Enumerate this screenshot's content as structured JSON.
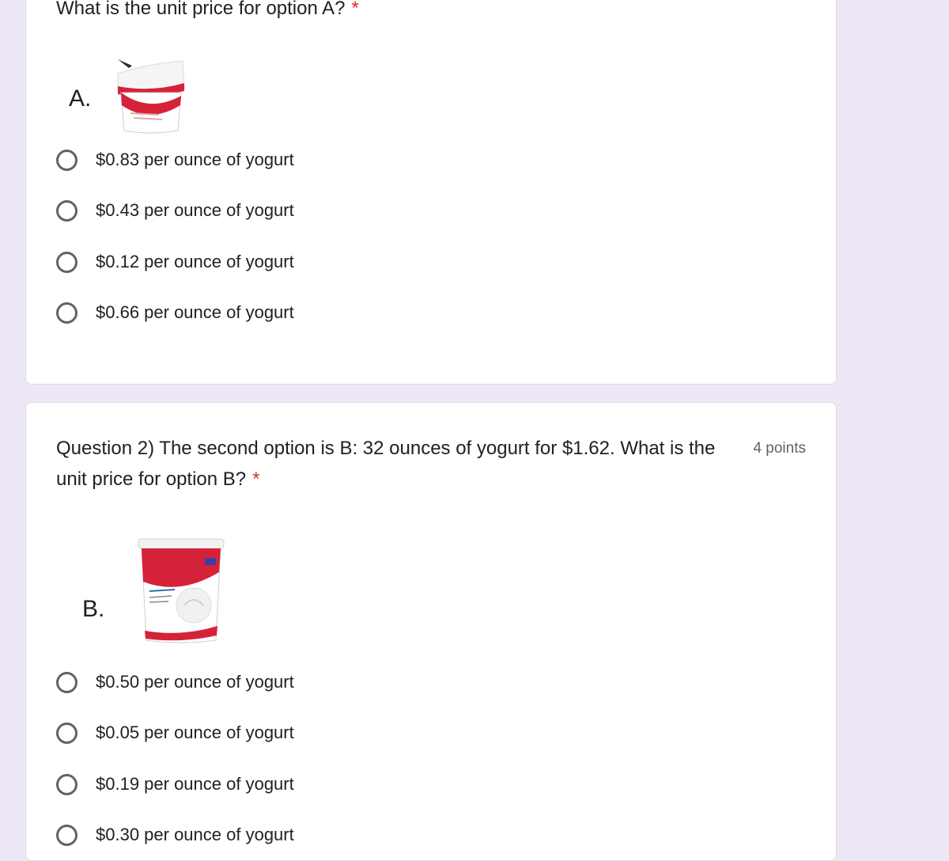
{
  "colors": {
    "background": "#EDE7F6",
    "card": "#FFFFFF",
    "required": "#D93025",
    "radio": "#5F6368",
    "yogurt_red": "#D62238"
  },
  "question1": {
    "title": "What is the unit price for option A?",
    "required_marker": "*",
    "image_label": "A.",
    "image_icon": "yogurt-cup-icon",
    "options": [
      "$0.83 per ounce of yogurt",
      "$0.43 per ounce of yogurt",
      "$0.12 per ounce of yogurt",
      "$0.66 per ounce of yogurt"
    ]
  },
  "question2": {
    "title": "Question 2) The second option is B: 32 ounces of yogurt for $1.62. What is the unit price for option B?",
    "required_marker": "*",
    "points": "4 points",
    "image_label": "B.",
    "image_icon": "yogurt-tub-icon",
    "options": [
      "$0.50 per ounce of yogurt",
      "$0.05 per ounce of yogurt",
      "$0.19 per ounce of yogurt",
      "$0.30 per ounce of yogurt"
    ]
  }
}
